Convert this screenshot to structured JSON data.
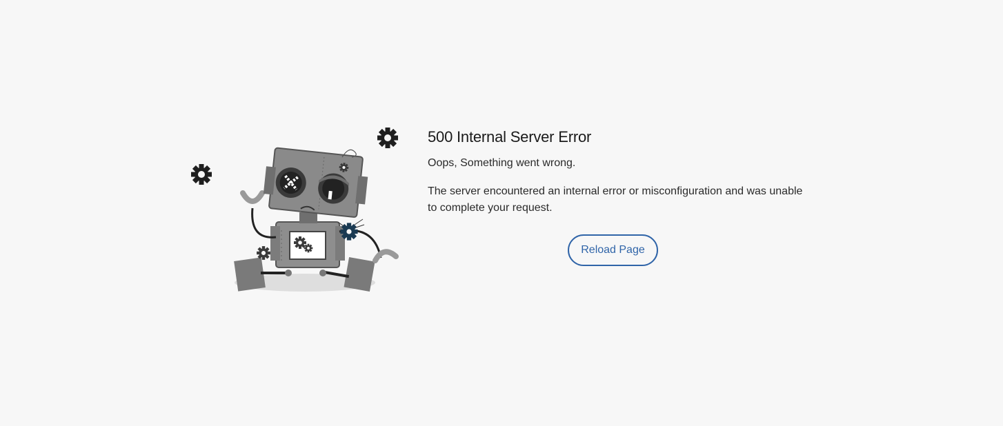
{
  "error": {
    "title": "500 Internal Server Error",
    "subtitle": "Oops, Something went wrong.",
    "message": "The server encountered an internal error or misconfiguration and was unable to complete your request."
  },
  "actions": {
    "reload_label": "Reload Page"
  },
  "colors": {
    "background": "#f7f7f7",
    "accent": "#2f64a8",
    "text": "#1a1a1a",
    "robot_gray": "#8a8a8a",
    "gear_dark": "#1f1f1f"
  },
  "illustration": {
    "icon": "broken-robot-illustration"
  }
}
